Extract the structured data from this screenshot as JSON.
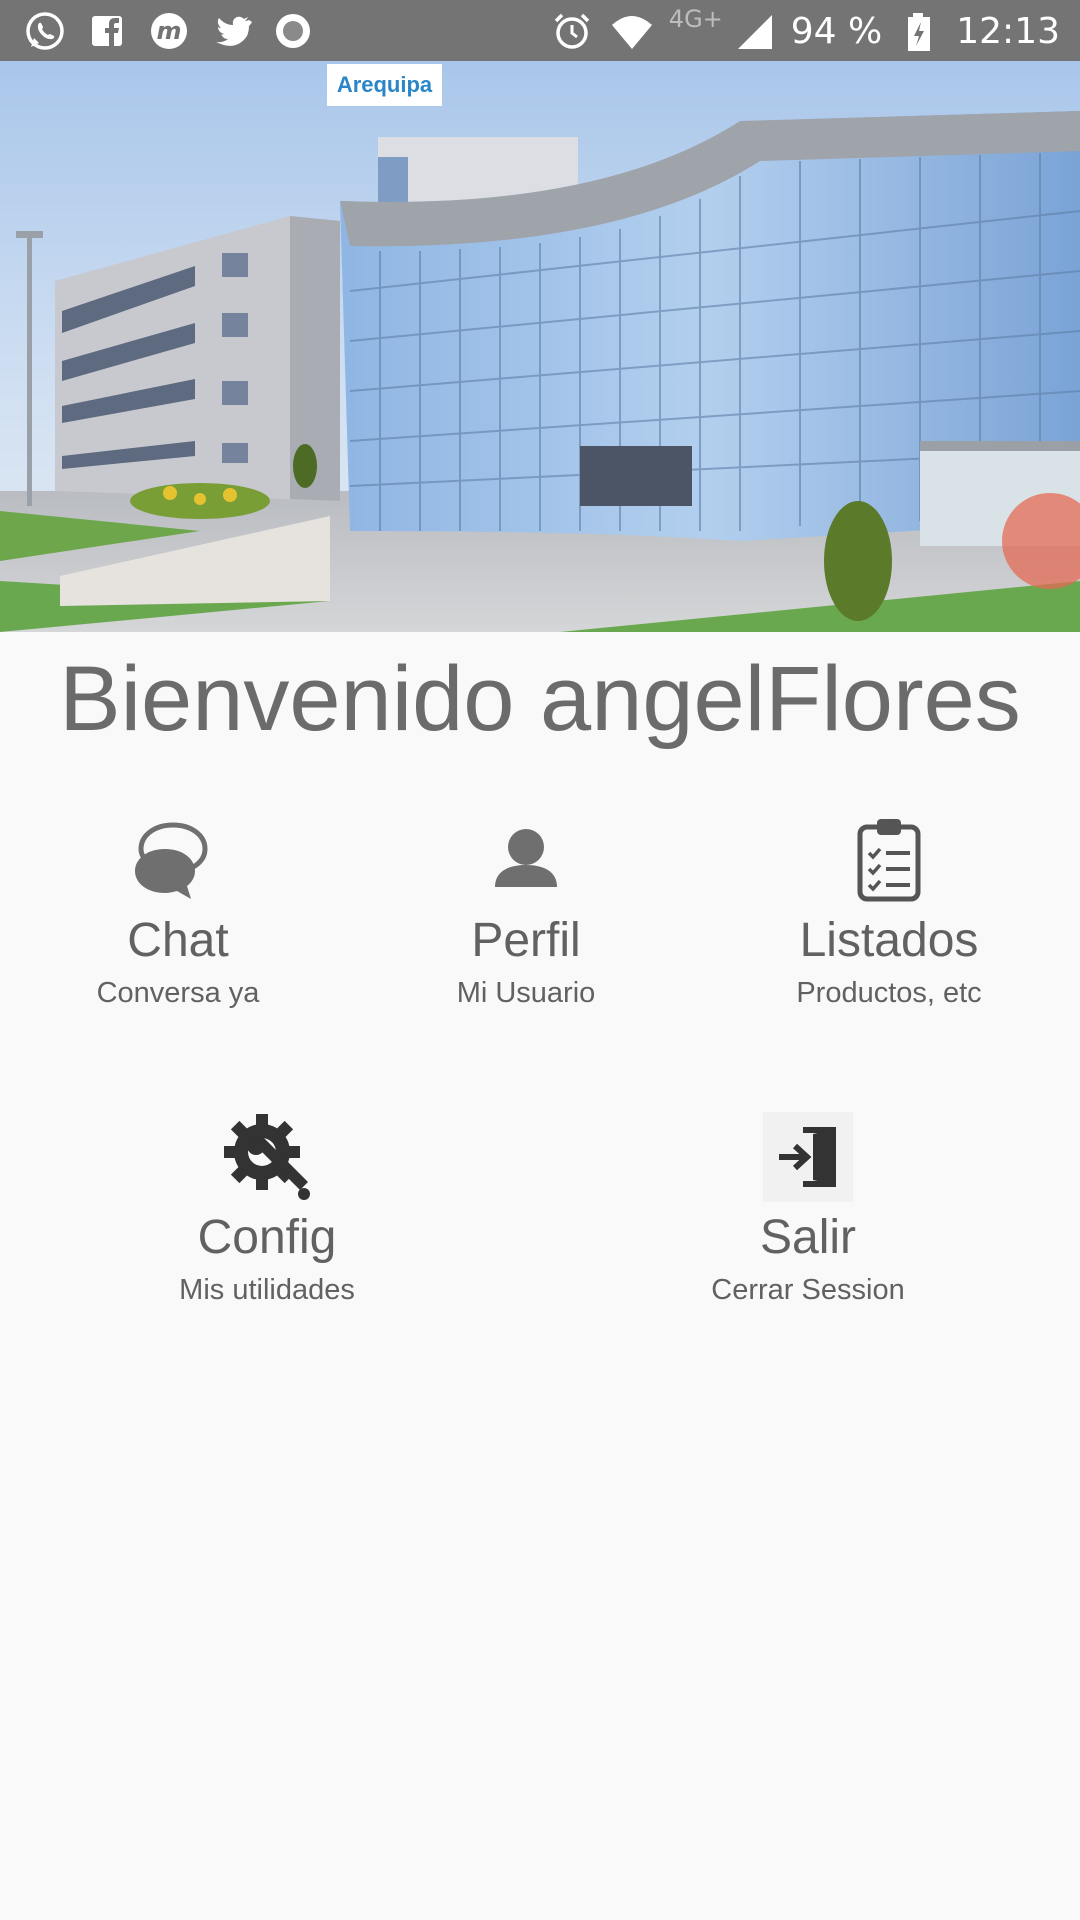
{
  "status_bar": {
    "network": "4G+",
    "battery_percent": "94 %",
    "time": "12:13",
    "left_icons": [
      "whatsapp-icon",
      "facebook-icon",
      "m-app-icon",
      "twitter-icon",
      "record-icon"
    ],
    "right_icons": [
      "alarm-icon",
      "wifi-icon",
      "signal-icon",
      "battery-charging-icon"
    ]
  },
  "hero": {
    "badge": "Arequipa"
  },
  "welcome": {
    "text": "Bienvenido angelFlores"
  },
  "menu": [
    {
      "title": "Chat",
      "subtitle": "Conversa ya",
      "icon": "chat-bubbles-icon"
    },
    {
      "title": "Perfil",
      "subtitle": "Mi Usuario",
      "icon": "user-icon"
    },
    {
      "title": "Listados",
      "subtitle": "Productos, etc",
      "icon": "clipboard-list-icon"
    },
    {
      "title": "Config",
      "subtitle": "Mis utilidades",
      "icon": "settings-wrench-icon"
    },
    {
      "title": "Salir",
      "subtitle": "Cerrar Session",
      "icon": "logout-icon"
    }
  ],
  "colors": {
    "status_bar": "#747474",
    "background": "#f9f9f9",
    "text": "#616161",
    "icon": "#6f6f6f"
  }
}
